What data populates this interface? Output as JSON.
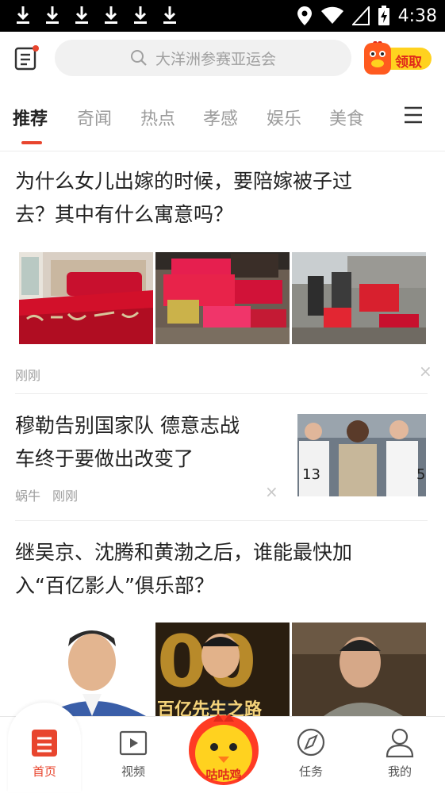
{
  "status_bar": {
    "time": "4:38",
    "download_icons": [
      "download-icon",
      "download-icon",
      "download-icon",
      "download-icon",
      "download-icon",
      "download-icon"
    ]
  },
  "header": {
    "search_placeholder": "大洋洲参赛亚运会",
    "reward_label": "领取"
  },
  "tabs": [
    {
      "label": "推荐",
      "active": true
    },
    {
      "label": "奇闻",
      "active": false
    },
    {
      "label": "热点",
      "active": false
    },
    {
      "label": "孝感",
      "active": false
    },
    {
      "label": "娱乐",
      "active": false
    },
    {
      "label": "美食",
      "active": false
    }
  ],
  "feed": {
    "articles": [
      {
        "title_line1": "为什么女儿出嫁的时候，要陪嫁被子过",
        "title_line2": "去？其中有什么寓意吗？",
        "time": "刚刚"
      },
      {
        "title_line1": "穆勒告别国家队 德意志战",
        "title_line2": "车终于要做出改变了",
        "source": "蜗牛",
        "time": "刚刚"
      },
      {
        "title_line1": "继吴京、沈腾和黄渤之后，谁能最快加",
        "title_line2": "入“百亿影人”俱乐部？",
        "thumb_text": "百亿先生之路"
      }
    ]
  },
  "bottom_nav": {
    "items": [
      {
        "label": "首页",
        "active": true
      },
      {
        "label": "视频",
        "active": false
      },
      {
        "label": "咕咕鸡",
        "active": false
      },
      {
        "label": "任务",
        "active": false
      },
      {
        "label": "我的",
        "active": false
      }
    ]
  },
  "colors": {
    "accent": "#e8452e",
    "status_bar": "#000000",
    "search_bg": "#f1f1f1",
    "reward_yellow": "#ffd21f"
  }
}
